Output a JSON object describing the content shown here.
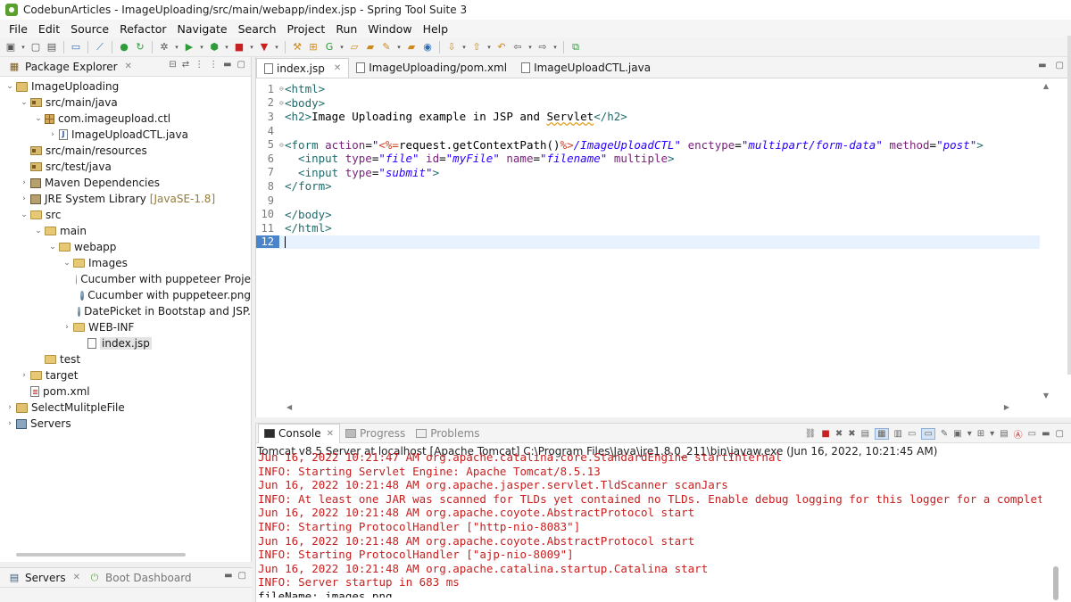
{
  "window": {
    "title": "CodebunArticles - ImageUploading/src/main/webapp/index.jsp - Spring Tool Suite 3"
  },
  "menu": [
    "File",
    "Edit",
    "Source",
    "Refactor",
    "Navigate",
    "Search",
    "Project",
    "Run",
    "Window",
    "Help"
  ],
  "package_explorer": {
    "title": "Package Explorer",
    "tree": [
      {
        "label": "ImageUploading",
        "twisty": "⌄",
        "icon": "project"
      },
      {
        "label": "src/main/java",
        "twisty": "⌄",
        "icon": "srcfolder"
      },
      {
        "label": "com.imageupload.ctl",
        "twisty": "⌄",
        "icon": "package"
      },
      {
        "label": "ImageUploadCTL.java",
        "twisty": "›",
        "icon": "javafile"
      },
      {
        "label": "src/main/resources",
        "twisty": "",
        "icon": "srcfolder"
      },
      {
        "label": "src/test/java",
        "twisty": "",
        "icon": "srcfolder"
      },
      {
        "label": "Maven Dependencies",
        "twisty": "›",
        "icon": "lib"
      },
      {
        "label": "JRE System Library",
        "suffix": "[JavaSE-1.8]",
        "twisty": "›",
        "icon": "lib"
      },
      {
        "label": "src",
        "twisty": "⌄",
        "icon": "folder"
      },
      {
        "label": "main",
        "twisty": "⌄",
        "icon": "folder"
      },
      {
        "label": "webapp",
        "twisty": "⌄",
        "icon": "folder"
      },
      {
        "label": "Images",
        "twisty": "⌄",
        "icon": "folder"
      },
      {
        "label": "Cucumber with puppeteer Proje",
        "twisty": "",
        "icon": "img"
      },
      {
        "label": "Cucumber with puppeteer.png",
        "twisty": "",
        "icon": "img"
      },
      {
        "label": "DatePicket in Bootstap and JSP.",
        "twisty": "",
        "icon": "img"
      },
      {
        "label": "WEB-INF",
        "twisty": "›",
        "icon": "folder"
      },
      {
        "label": "index.jsp",
        "twisty": "",
        "icon": "jsp",
        "selected": true
      },
      {
        "label": "test",
        "twisty": "",
        "icon": "folder"
      },
      {
        "label": "target",
        "twisty": "›",
        "icon": "folder"
      },
      {
        "label": "pom.xml",
        "twisty": "",
        "icon": "xml"
      },
      {
        "label": "SelectMulitpleFile",
        "twisty": "›",
        "icon": "project"
      },
      {
        "label": "Servers",
        "twisty": "›",
        "icon": "servers"
      }
    ]
  },
  "servers_view": {
    "title": "Servers",
    "boot_dashboard": "Boot Dashboard"
  },
  "editor": {
    "tabs": [
      "index.jsp",
      "ImageUploading/pom.xml",
      "ImageUploadCTL.java"
    ],
    "line_numbers": [
      "1",
      "2",
      "3",
      "4",
      "5",
      "6",
      "7",
      "8",
      "9",
      "10",
      "11",
      "12"
    ],
    "code": {
      "l1": "<html>",
      "l2": "<body>",
      "l3_open": "<h2>",
      "l3_text": "Image Uploading example in JSP and ",
      "l3_word": "Servlet",
      "l3_close": "</h2>",
      "l5_open": "<form ",
      "l5_a1": "action",
      "l5_eq": "=",
      "l5_q1": "\"",
      "l5_jsp_open": "<%=",
      "l5_expr": "request.getContextPath()",
      "l5_jsp_close": "%>",
      "l5_path": "/ImageUploadCTL\"",
      "l5_a2": " enctype",
      "l5_v2": "\"multipart/form-data\"",
      "l5_a3": " method",
      "l5_v3": "\"post\"",
      "l5_end": ">",
      "l6_open": "  <input ",
      "l6_a1": "type",
      "l6_v1": "\"file\"",
      "l6_a2": " id",
      "l6_v2": "\"myFile\"",
      "l6_a3": " name",
      "l6_v3": "\"filename\"",
      "l6_a4": " multiple",
      "l6_end": ">",
      "l7_open": "  <input ",
      "l7_a1": "type",
      "l7_v1": "\"submit\"",
      "l7_end": ">",
      "l8": "</form>",
      "l10": "</body>",
      "l11": "</html>"
    }
  },
  "console": {
    "tabs": [
      "Console",
      "Progress",
      "Problems"
    ],
    "description": "Tomcat v8.5 Server at localhost [Apache Tomcat] C:\\Program Files\\Java\\jre1.8.0_211\\bin\\javaw.exe  (Jun 16, 2022, 10:21:45 AM)",
    "lines": [
      "Jun 16, 2022 10:21:47 AM org.apache.catalina.core.StandardEngine startInternal",
      "INFO: Starting Servlet Engine: Apache Tomcat/8.5.13",
      "Jun 16, 2022 10:21:48 AM org.apache.jasper.servlet.TldScanner scanJars",
      "INFO: At least one JAR was scanned for TLDs yet contained no TLDs. Enable debug logging for this logger for a complete list of",
      "Jun 16, 2022 10:21:48 AM org.apache.coyote.AbstractProtocol start",
      "INFO: Starting ProtocolHandler [\"http-nio-8083\"]",
      "Jun 16, 2022 10:21:48 AM org.apache.coyote.AbstractProtocol start",
      "INFO: Starting ProtocolHandler [\"ajp-nio-8009\"]",
      "Jun 16, 2022 10:21:48 AM org.apache.catalina.startup.Catalina start",
      "INFO: Server startup in 683 ms",
      "fileName: images.png"
    ]
  }
}
